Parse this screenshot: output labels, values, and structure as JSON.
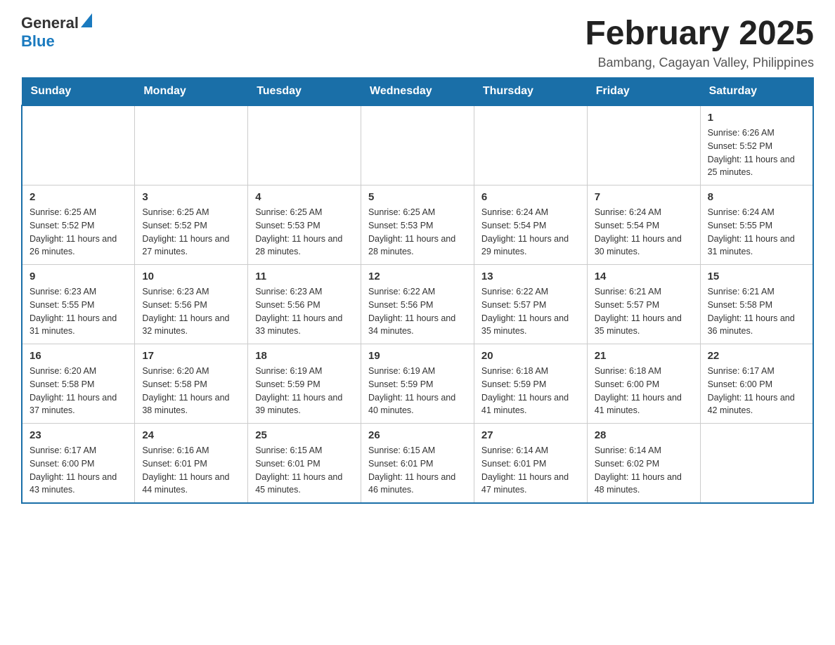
{
  "header": {
    "logo": {
      "general": "General",
      "blue": "Blue"
    },
    "title": "February 2025",
    "subtitle": "Bambang, Cagayan Valley, Philippines"
  },
  "calendar": {
    "days_of_week": [
      "Sunday",
      "Monday",
      "Tuesday",
      "Wednesday",
      "Thursday",
      "Friday",
      "Saturday"
    ],
    "weeks": [
      {
        "cells": [
          {
            "empty": true
          },
          {
            "empty": true
          },
          {
            "empty": true
          },
          {
            "empty": true
          },
          {
            "empty": true
          },
          {
            "empty": true
          },
          {
            "day": "1",
            "sunrise": "Sunrise: 6:26 AM",
            "sunset": "Sunset: 5:52 PM",
            "daylight": "Daylight: 11 hours and 25 minutes."
          }
        ]
      },
      {
        "cells": [
          {
            "day": "2",
            "sunrise": "Sunrise: 6:25 AM",
            "sunset": "Sunset: 5:52 PM",
            "daylight": "Daylight: 11 hours and 26 minutes."
          },
          {
            "day": "3",
            "sunrise": "Sunrise: 6:25 AM",
            "sunset": "Sunset: 5:52 PM",
            "daylight": "Daylight: 11 hours and 27 minutes."
          },
          {
            "day": "4",
            "sunrise": "Sunrise: 6:25 AM",
            "sunset": "Sunset: 5:53 PM",
            "daylight": "Daylight: 11 hours and 28 minutes."
          },
          {
            "day": "5",
            "sunrise": "Sunrise: 6:25 AM",
            "sunset": "Sunset: 5:53 PM",
            "daylight": "Daylight: 11 hours and 28 minutes."
          },
          {
            "day": "6",
            "sunrise": "Sunrise: 6:24 AM",
            "sunset": "Sunset: 5:54 PM",
            "daylight": "Daylight: 11 hours and 29 minutes."
          },
          {
            "day": "7",
            "sunrise": "Sunrise: 6:24 AM",
            "sunset": "Sunset: 5:54 PM",
            "daylight": "Daylight: 11 hours and 30 minutes."
          },
          {
            "day": "8",
            "sunrise": "Sunrise: 6:24 AM",
            "sunset": "Sunset: 5:55 PM",
            "daylight": "Daylight: 11 hours and 31 minutes."
          }
        ]
      },
      {
        "cells": [
          {
            "day": "9",
            "sunrise": "Sunrise: 6:23 AM",
            "sunset": "Sunset: 5:55 PM",
            "daylight": "Daylight: 11 hours and 31 minutes."
          },
          {
            "day": "10",
            "sunrise": "Sunrise: 6:23 AM",
            "sunset": "Sunset: 5:56 PM",
            "daylight": "Daylight: 11 hours and 32 minutes."
          },
          {
            "day": "11",
            "sunrise": "Sunrise: 6:23 AM",
            "sunset": "Sunset: 5:56 PM",
            "daylight": "Daylight: 11 hours and 33 minutes."
          },
          {
            "day": "12",
            "sunrise": "Sunrise: 6:22 AM",
            "sunset": "Sunset: 5:56 PM",
            "daylight": "Daylight: 11 hours and 34 minutes."
          },
          {
            "day": "13",
            "sunrise": "Sunrise: 6:22 AM",
            "sunset": "Sunset: 5:57 PM",
            "daylight": "Daylight: 11 hours and 35 minutes."
          },
          {
            "day": "14",
            "sunrise": "Sunrise: 6:21 AM",
            "sunset": "Sunset: 5:57 PM",
            "daylight": "Daylight: 11 hours and 35 minutes."
          },
          {
            "day": "15",
            "sunrise": "Sunrise: 6:21 AM",
            "sunset": "Sunset: 5:58 PM",
            "daylight": "Daylight: 11 hours and 36 minutes."
          }
        ]
      },
      {
        "cells": [
          {
            "day": "16",
            "sunrise": "Sunrise: 6:20 AM",
            "sunset": "Sunset: 5:58 PM",
            "daylight": "Daylight: 11 hours and 37 minutes."
          },
          {
            "day": "17",
            "sunrise": "Sunrise: 6:20 AM",
            "sunset": "Sunset: 5:58 PM",
            "daylight": "Daylight: 11 hours and 38 minutes."
          },
          {
            "day": "18",
            "sunrise": "Sunrise: 6:19 AM",
            "sunset": "Sunset: 5:59 PM",
            "daylight": "Daylight: 11 hours and 39 minutes."
          },
          {
            "day": "19",
            "sunrise": "Sunrise: 6:19 AM",
            "sunset": "Sunset: 5:59 PM",
            "daylight": "Daylight: 11 hours and 40 minutes."
          },
          {
            "day": "20",
            "sunrise": "Sunrise: 6:18 AM",
            "sunset": "Sunset: 5:59 PM",
            "daylight": "Daylight: 11 hours and 41 minutes."
          },
          {
            "day": "21",
            "sunrise": "Sunrise: 6:18 AM",
            "sunset": "Sunset: 6:00 PM",
            "daylight": "Daylight: 11 hours and 41 minutes."
          },
          {
            "day": "22",
            "sunrise": "Sunrise: 6:17 AM",
            "sunset": "Sunset: 6:00 PM",
            "daylight": "Daylight: 11 hours and 42 minutes."
          }
        ]
      },
      {
        "cells": [
          {
            "day": "23",
            "sunrise": "Sunrise: 6:17 AM",
            "sunset": "Sunset: 6:00 PM",
            "daylight": "Daylight: 11 hours and 43 minutes."
          },
          {
            "day": "24",
            "sunrise": "Sunrise: 6:16 AM",
            "sunset": "Sunset: 6:01 PM",
            "daylight": "Daylight: 11 hours and 44 minutes."
          },
          {
            "day": "25",
            "sunrise": "Sunrise: 6:15 AM",
            "sunset": "Sunset: 6:01 PM",
            "daylight": "Daylight: 11 hours and 45 minutes."
          },
          {
            "day": "26",
            "sunrise": "Sunrise: 6:15 AM",
            "sunset": "Sunset: 6:01 PM",
            "daylight": "Daylight: 11 hours and 46 minutes."
          },
          {
            "day": "27",
            "sunrise": "Sunrise: 6:14 AM",
            "sunset": "Sunset: 6:01 PM",
            "daylight": "Daylight: 11 hours and 47 minutes."
          },
          {
            "day": "28",
            "sunrise": "Sunrise: 6:14 AM",
            "sunset": "Sunset: 6:02 PM",
            "daylight": "Daylight: 11 hours and 48 minutes."
          },
          {
            "empty": true
          }
        ]
      }
    ]
  }
}
